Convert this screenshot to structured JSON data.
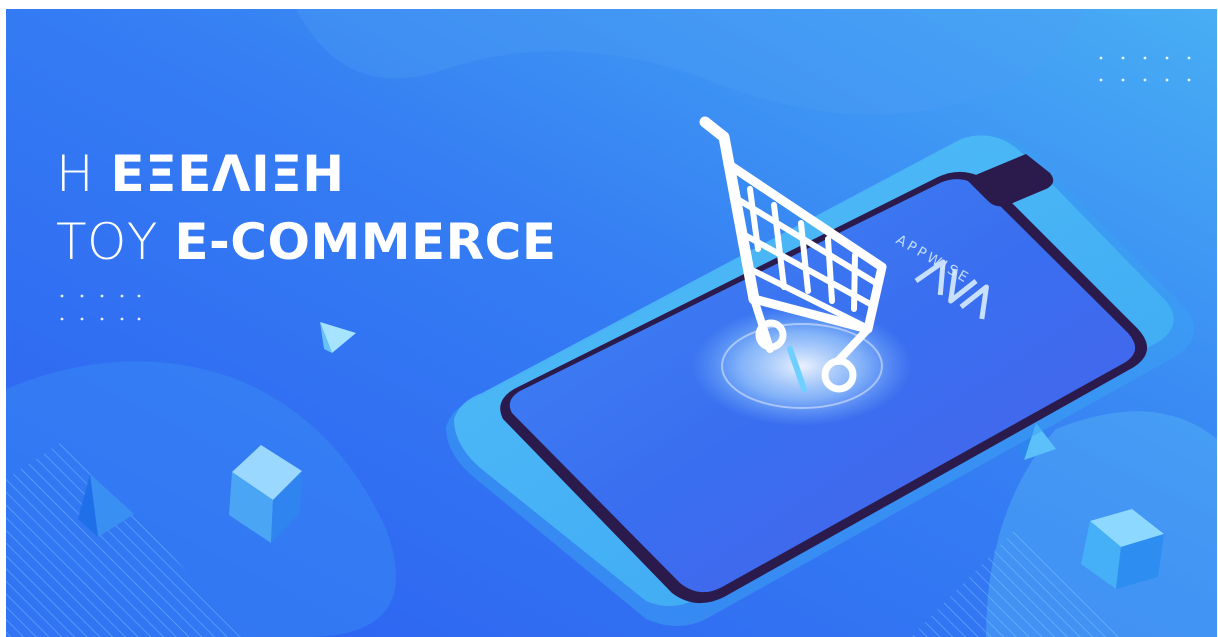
{
  "headline": {
    "line1_light": "Η ",
    "line1_bold": "ΕΞΕΛΙΞΗ",
    "line2_light": "ΤΟΥ ",
    "line2_bold": "E-COMMERCE"
  },
  "brand": {
    "logo_icon": "appwise-logo-icon",
    "name": "APPWISE"
  },
  "icons": [
    "shopping-cart-icon",
    "appwise-logo-icon"
  ],
  "colors": {
    "bg_light": "#42a6f3",
    "bg_dark": "#2a5ff2",
    "phone_frame": "#281a4a",
    "screen": "#3a78f0",
    "cart": "#ffffff"
  }
}
